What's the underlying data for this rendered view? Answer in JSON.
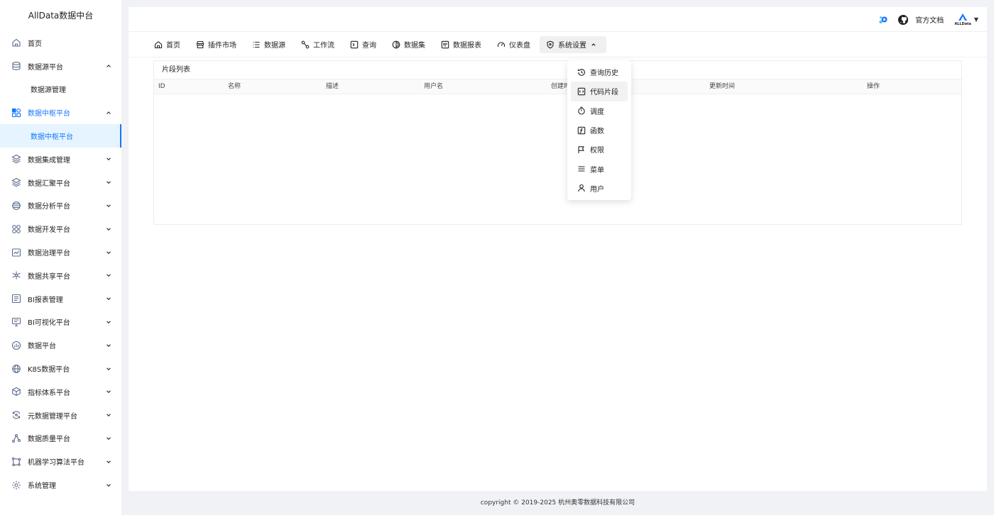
{
  "sidebar": {
    "brand": "AllData数据中台",
    "items": [
      {
        "label": "首页",
        "icon": "home-icon"
      },
      {
        "label": "数据源平台",
        "icon": "database-icon",
        "arrow": "up"
      },
      {
        "label": "数据源管理",
        "sub": true
      },
      {
        "label": "数据中枢平台",
        "icon": "apps-icon",
        "arrow": "up",
        "open": true
      },
      {
        "label": "数据中枢平台",
        "sub": true,
        "active": true
      },
      {
        "label": "数据集成管理",
        "icon": "layers-icon",
        "arrow": "down"
      },
      {
        "label": "数据汇聚平台",
        "icon": "layers-icon",
        "arrow": "down"
      },
      {
        "label": "数据分析平台",
        "icon": "globe-icon",
        "arrow": "down"
      },
      {
        "label": "数据开发平台",
        "icon": "nodes-icon",
        "arrow": "down"
      },
      {
        "label": "数据治理平台",
        "icon": "chart-monitor-icon",
        "arrow": "down"
      },
      {
        "label": "数据共享平台",
        "icon": "share-icon",
        "arrow": "down"
      },
      {
        "label": "BI报表管理",
        "icon": "report-icon",
        "arrow": "down"
      },
      {
        "label": "BI可视化平台",
        "icon": "monitor-icon",
        "arrow": "down"
      },
      {
        "label": "数据平台",
        "icon": "bar-chart-icon",
        "arrow": "down"
      },
      {
        "label": "K8S数据平台",
        "icon": "globe-icon",
        "arrow": "down"
      },
      {
        "label": "指标体系平台",
        "icon": "cube-icon",
        "arrow": "down"
      },
      {
        "label": "元数据管理平台",
        "icon": "refresh-icon",
        "arrow": "down"
      },
      {
        "label": "数据质量平台",
        "icon": "scatter-icon",
        "arrow": "down"
      },
      {
        "label": "机器学习算法平台",
        "icon": "graph-icon",
        "arrow": "down"
      },
      {
        "label": "系统管理",
        "icon": "settings-icon",
        "arrow": "down"
      }
    ]
  },
  "topbar": {
    "docs_label": "官方文档",
    "logo_text": "ALLData",
    "caret": "▼"
  },
  "navbar": {
    "items": [
      {
        "label": "首页",
        "icon": "home-icon"
      },
      {
        "label": "插件市场",
        "icon": "store-icon"
      },
      {
        "label": "数据源",
        "icon": "list-icon"
      },
      {
        "label": "工作流",
        "icon": "workflow-icon"
      },
      {
        "label": "查询",
        "icon": "terminal-icon"
      },
      {
        "label": "数据集",
        "icon": "dataset-icon"
      },
      {
        "label": "数据报表",
        "icon": "report-icon"
      },
      {
        "label": "仪表盘",
        "icon": "gauge-icon"
      },
      {
        "label": "系统设置",
        "icon": "shield-icon",
        "active": true
      }
    ]
  },
  "card": {
    "title": "片段列表",
    "columns": [
      "ID",
      "名称",
      "描述",
      "用户名",
      "创建时",
      "更新时间",
      "操作"
    ]
  },
  "dropdown": {
    "items": [
      {
        "label": "查询历史",
        "icon": "history-icon"
      },
      {
        "label": "代码片段",
        "icon": "code-icon",
        "hover": true
      },
      {
        "label": "调度",
        "icon": "timer-icon"
      },
      {
        "label": "函数",
        "icon": "function-icon"
      },
      {
        "label": "权限",
        "icon": "flag-icon"
      },
      {
        "label": "菜单",
        "icon": "menu-icon"
      },
      {
        "label": "用户",
        "icon": "user-icon"
      }
    ]
  },
  "footer": {
    "text": "copyright © 2019-2025 杭州奥零数据科技有限公司"
  },
  "colors": {
    "accent": "#1677ff",
    "active_bg": "#e6f4ff"
  }
}
